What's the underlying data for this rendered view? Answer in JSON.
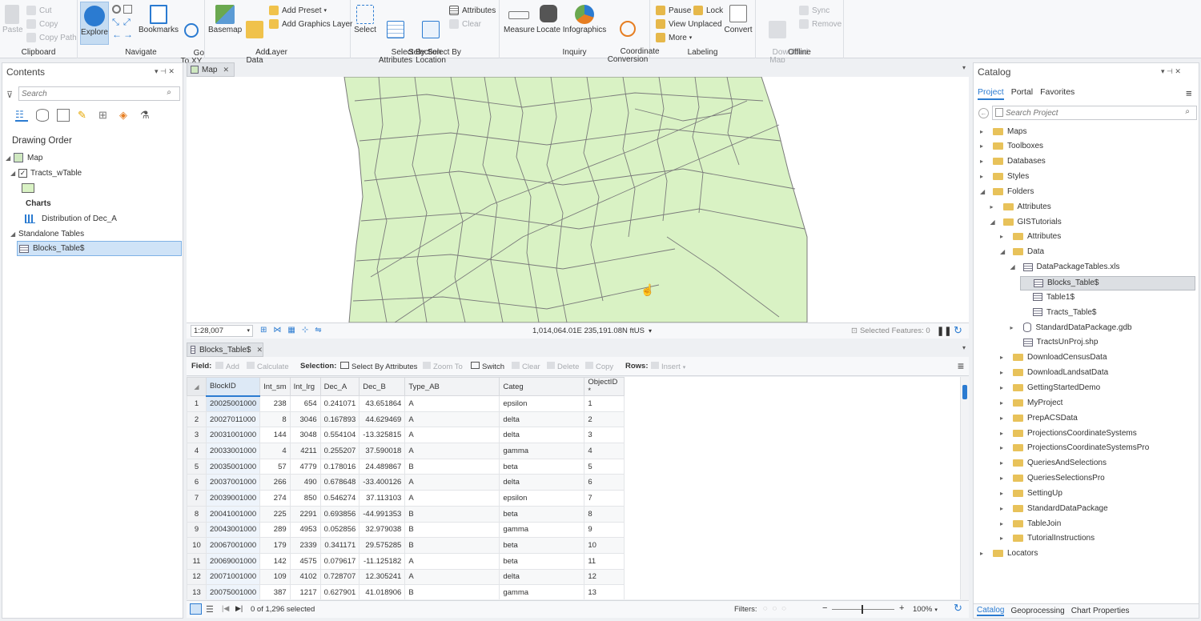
{
  "ribbon": {
    "clipboard": {
      "paste": "Paste",
      "cut": "Cut",
      "copy": "Copy",
      "copy_path": "Copy Path",
      "label": "Clipboard"
    },
    "navigate": {
      "explore": "Explore",
      "bookmarks": "Bookmarks",
      "goto": "Go\nTo XY",
      "label": "Navigate"
    },
    "layer": {
      "basemap": "Basemap",
      "add_data": "Add\nData",
      "add_preset": "Add Preset",
      "add_graphics": "Add Graphics Layer",
      "label": "Layer"
    },
    "selection": {
      "select": "Select",
      "select_attr": "Select By\nAttributes",
      "select_loc": "Select By\nLocation",
      "attributes": "Attributes",
      "clear": "Clear",
      "label": "Selection"
    },
    "inquiry": {
      "measure": "Measure",
      "locate": "Locate",
      "infographics": "Infographics",
      "coord": "Coordinate\nConversion",
      "label": "Inquiry"
    },
    "labeling": {
      "pause": "Pause",
      "lock": "Lock",
      "view_unplaced": "View Unplaced",
      "more": "More",
      "convert": "Convert",
      "label": "Labeling"
    },
    "offline": {
      "download": "Download\nMap",
      "sync": "Sync",
      "remove": "Remove",
      "label": "Offline"
    }
  },
  "contents": {
    "title": "Contents",
    "search_placeholder": "Search",
    "drawing_order": "Drawing Order",
    "map": "Map",
    "layer": "Tracts_wTable",
    "charts": "Charts",
    "chart_item": "Distribution of Dec_A",
    "standalone": "Standalone Tables",
    "table_item": "Blocks_Table$"
  },
  "map_view": {
    "tab": "Map",
    "scale": "1:28,007",
    "coords": "1,014,064.01E 235,191.08N ftUS",
    "selected_features": "Selected Features: 0"
  },
  "table_view": {
    "tab": "Blocks_Table$",
    "field_label": "Field:",
    "add": "Add",
    "calculate": "Calculate",
    "selection_label": "Selection:",
    "select_by_attr": "Select By Attributes",
    "zoom_to": "Zoom To",
    "switch": "Switch",
    "clear": "Clear",
    "delete": "Delete",
    "copy": "Copy",
    "rows_label": "Rows:",
    "insert": "Insert",
    "columns": [
      "BlockID",
      "Int_sm",
      "Int_lrg",
      "Dec_A",
      "Dec_B",
      "Type_AB",
      "Categ",
      "ObjectID *"
    ],
    "rows": [
      [
        "1",
        "20025001000",
        "238",
        "654",
        "0.241071",
        "43.651864",
        "A",
        "epsilon",
        "1"
      ],
      [
        "2",
        "20027011000",
        "8",
        "3046",
        "0.167893",
        "44.629469",
        "A",
        "delta",
        "2"
      ],
      [
        "3",
        "20031001000",
        "144",
        "3048",
        "0.554104",
        "-13.325815",
        "A",
        "delta",
        "3"
      ],
      [
        "4",
        "20033001000",
        "4",
        "4211",
        "0.255207",
        "37.590018",
        "A",
        "gamma",
        "4"
      ],
      [
        "5",
        "20035001000",
        "57",
        "4779",
        "0.178016",
        "24.489867",
        "B",
        "beta",
        "5"
      ],
      [
        "6",
        "20037001000",
        "266",
        "490",
        "0.678648",
        "-33.400126",
        "A",
        "delta",
        "6"
      ],
      [
        "7",
        "20039001000",
        "274",
        "850",
        "0.546274",
        "37.113103",
        "A",
        "epsilon",
        "7"
      ],
      [
        "8",
        "20041001000",
        "225",
        "2291",
        "0.693856",
        "-44.991353",
        "B",
        "beta",
        "8"
      ],
      [
        "9",
        "20043001000",
        "289",
        "4953",
        "0.052856",
        "32.979038",
        "B",
        "gamma",
        "9"
      ],
      [
        "10",
        "20067001000",
        "179",
        "2339",
        "0.341171",
        "29.575285",
        "B",
        "beta",
        "10"
      ],
      [
        "11",
        "20069001000",
        "142",
        "4575",
        "0.079617",
        "-11.125182",
        "A",
        "beta",
        "11"
      ],
      [
        "12",
        "20071001000",
        "109",
        "4102",
        "0.728707",
        "12.305241",
        "A",
        "delta",
        "12"
      ],
      [
        "13",
        "20075001000",
        "387",
        "1217",
        "0.627901",
        "41.018906",
        "B",
        "gamma",
        "13"
      ]
    ],
    "status": "0 of 1,296 selected",
    "filters": "Filters:",
    "zoom": "100%"
  },
  "catalog": {
    "title": "Catalog",
    "tabs": [
      "Project",
      "Portal",
      "Favorites"
    ],
    "search_placeholder": "Search Project",
    "items": [
      {
        "label": "Maps",
        "indent": 0,
        "arrow": "▸",
        "icon": "folder"
      },
      {
        "label": "Toolboxes",
        "indent": 0,
        "arrow": "▸",
        "icon": "folder"
      },
      {
        "label": "Databases",
        "indent": 0,
        "arrow": "▸",
        "icon": "folder"
      },
      {
        "label": "Styles",
        "indent": 0,
        "arrow": "▸",
        "icon": "folder"
      },
      {
        "label": "Folders",
        "indent": 0,
        "arrow": "◢",
        "icon": "folder"
      },
      {
        "label": "Attributes",
        "indent": 1,
        "arrow": "▸",
        "icon": "folder"
      },
      {
        "label": "GISTutorials",
        "indent": 1,
        "arrow": "◢",
        "icon": "folder"
      },
      {
        "label": "Attributes",
        "indent": 2,
        "arrow": "▸",
        "icon": "folder"
      },
      {
        "label": "Data",
        "indent": 2,
        "arrow": "◢",
        "icon": "folder"
      },
      {
        "label": "DataPackageTables.xls",
        "indent": 3,
        "arrow": "◢",
        "icon": "table"
      },
      {
        "label": "Blocks_Table$",
        "indent": 4,
        "arrow": "",
        "icon": "table"
      },
      {
        "label": "Table1$",
        "indent": 4,
        "arrow": "",
        "icon": "table"
      },
      {
        "label": "Tracts_Table$",
        "indent": 4,
        "arrow": "",
        "icon": "table"
      },
      {
        "label": "StandardDataPackage.gdb",
        "indent": 3,
        "arrow": "▸",
        "icon": "gdb"
      },
      {
        "label": "TractsUnProj.shp",
        "indent": 3,
        "arrow": "",
        "icon": "table"
      },
      {
        "label": "DownloadCensusData",
        "indent": 2,
        "arrow": "▸",
        "icon": "folder"
      },
      {
        "label": "DownloadLandsatData",
        "indent": 2,
        "arrow": "▸",
        "icon": "folder"
      },
      {
        "label": "GettingStartedDemo",
        "indent": 2,
        "arrow": "▸",
        "icon": "folder"
      },
      {
        "label": "MyProject",
        "indent": 2,
        "arrow": "▸",
        "icon": "folder"
      },
      {
        "label": "PrepACSData",
        "indent": 2,
        "arrow": "▸",
        "icon": "folder"
      },
      {
        "label": "ProjectionsCoordinateSystems",
        "indent": 2,
        "arrow": "▸",
        "icon": "folder"
      },
      {
        "label": "ProjectionsCoordinateSystemsPro",
        "indent": 2,
        "arrow": "▸",
        "icon": "folder"
      },
      {
        "label": "QueriesAndSelections",
        "indent": 2,
        "arrow": "▸",
        "icon": "folder"
      },
      {
        "label": "QueriesSelectionsPro",
        "indent": 2,
        "arrow": "▸",
        "icon": "folder"
      },
      {
        "label": "SettingUp",
        "indent": 2,
        "arrow": "▸",
        "icon": "folder"
      },
      {
        "label": "StandardDataPackage",
        "indent": 2,
        "arrow": "▸",
        "icon": "folder"
      },
      {
        "label": "TableJoin",
        "indent": 2,
        "arrow": "▸",
        "icon": "folder"
      },
      {
        "label": "TutorialInstructions",
        "indent": 2,
        "arrow": "▸",
        "icon": "folder"
      },
      {
        "label": "Locators",
        "indent": 0,
        "arrow": "▸",
        "icon": "folder"
      }
    ],
    "bottom_tabs": [
      "Catalog",
      "Geoprocessing",
      "Chart Properties"
    ]
  },
  "colors": {
    "accent": "#2b7bd1",
    "map_fill": "#d9f2c4",
    "map_line": "#666666",
    "selected": "#cfe3f7"
  }
}
